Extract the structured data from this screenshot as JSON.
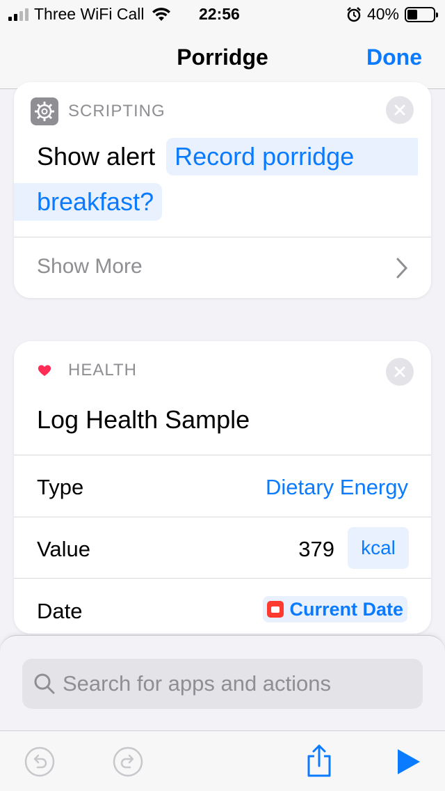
{
  "status_bar": {
    "carrier": "Three WiFi Call",
    "time": "22:56",
    "battery": "40%",
    "battery_level": 0.4
  },
  "nav": {
    "title": "Porridge",
    "done_label": "Done"
  },
  "scripting_card": {
    "category": "SCRIPTING",
    "action_label": "Show alert",
    "alert_text_line1": "Record porridge",
    "alert_text_line2": "breakfast?",
    "show_more_label": "Show More"
  },
  "health_card": {
    "category": "HEALTH",
    "title": "Log Health Sample",
    "rows": [
      {
        "label": "Type",
        "value": "Dietary Energy"
      },
      {
        "label": "Value",
        "value": "379",
        "unit": "kcal"
      },
      {
        "label": "Date",
        "value": "Current Date"
      }
    ]
  },
  "search": {
    "placeholder": "Search for apps and actions"
  },
  "colors": {
    "accent": "#0a7aff",
    "heart": "#ff2d55",
    "calendar": "#ff3b30"
  },
  "icons": [
    "gear-icon",
    "heart-icon",
    "close-icon",
    "chevron-right-icon",
    "calendar-icon",
    "search-icon",
    "undo-icon",
    "redo-icon",
    "share-icon",
    "play-icon"
  ]
}
